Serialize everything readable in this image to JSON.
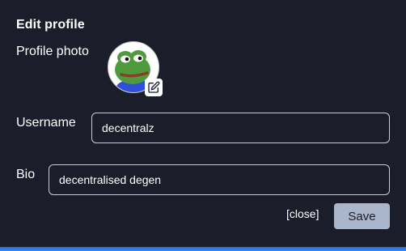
{
  "dialog": {
    "title": "Edit profile"
  },
  "profile_photo": {
    "label": "Profile photo",
    "edit_icon": "edit-pencil-icon"
  },
  "username": {
    "label": "Username",
    "value": "decentralz"
  },
  "bio": {
    "label": "Bio",
    "value": "decentralised degen"
  },
  "actions": {
    "close_label": "[close]",
    "save_label": "Save"
  },
  "colors": {
    "background": "#1c1d2a",
    "input_border": "#c9ccd4",
    "save_button_bg": "#a9b6cb",
    "bottom_accent": "#3b86f0"
  }
}
